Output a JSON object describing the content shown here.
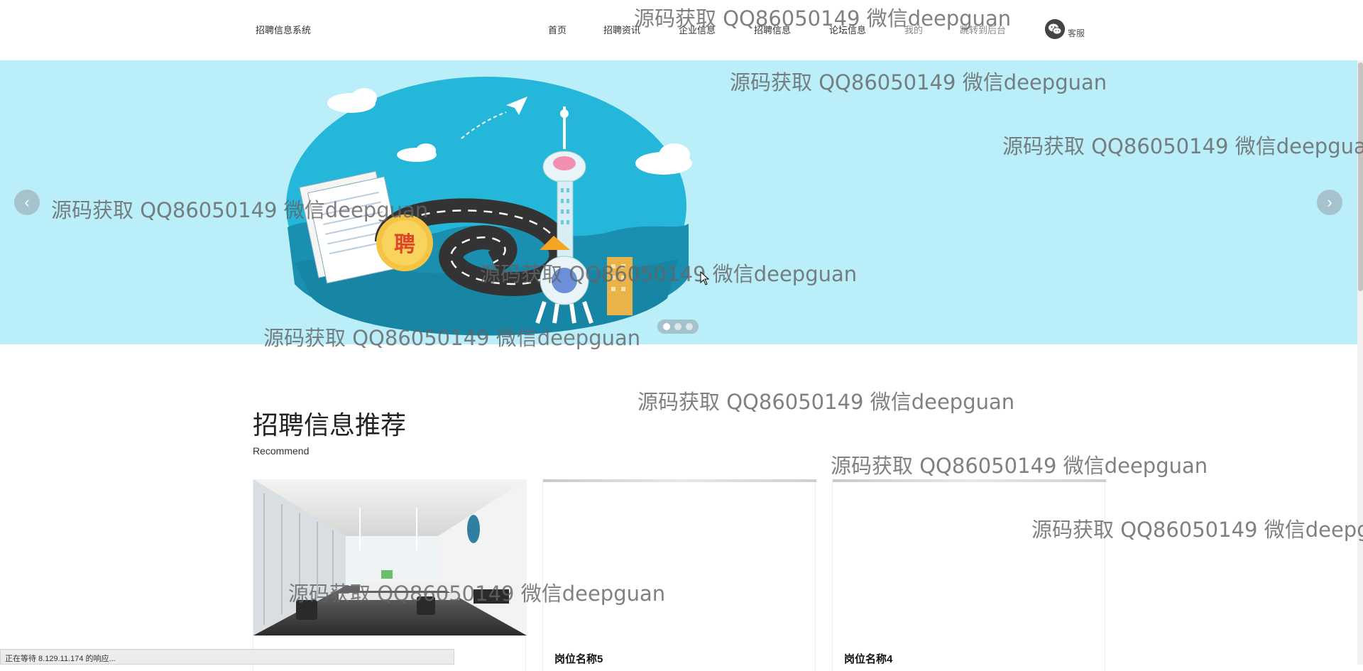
{
  "header": {
    "brand": "招聘信息系统",
    "nav": [
      "首页",
      "招聘资讯",
      "企业信息",
      "招聘信息",
      "论坛信息",
      "我的",
      "跳转到后台"
    ],
    "kefu_label": "客服",
    "kefu_icon": "wechat-icon"
  },
  "banner": {
    "badge_text": "聘",
    "arrow_left": "‹",
    "arrow_right": "›",
    "slides": 3,
    "active_slide": 1,
    "background": "#baeef8"
  },
  "section": {
    "title": "招聘信息推荐",
    "subtitle": "Recommend"
  },
  "cards": [
    {
      "title": "",
      "image": "office-photo"
    },
    {
      "title": "岗位名称5",
      "image": "loading"
    },
    {
      "title": "岗位名称4",
      "image": "loading"
    }
  ],
  "statusbar": {
    "text": "正在等待 8.129.11.174 的响应..."
  },
  "watermark": "源码获取 QQ86050149 微信deepguan"
}
